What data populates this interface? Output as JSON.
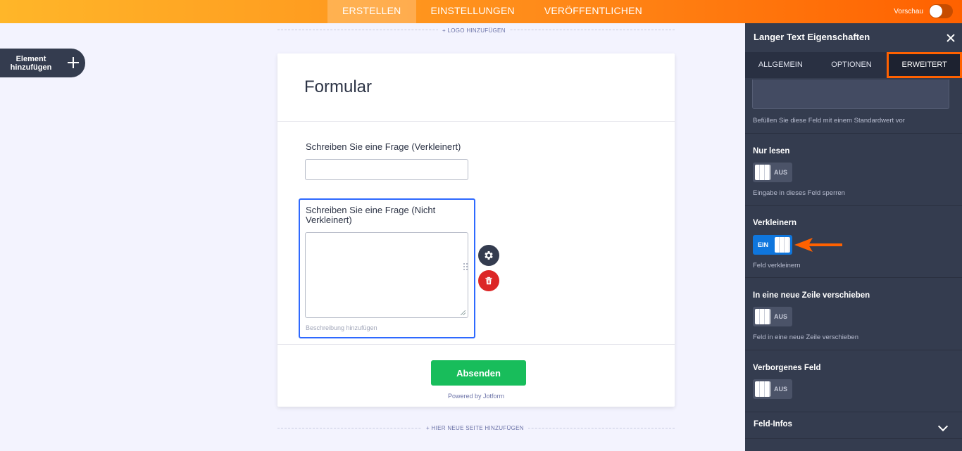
{
  "topbar": {
    "tabs": [
      "ERSTELLEN",
      "EINSTELLUNGEN",
      "VERÖFFENTLICHEN"
    ],
    "active_tab": "ERSTELLEN",
    "preview_label": "Vorschau"
  },
  "sidebar": {
    "add_element_line1": "Element",
    "add_element_line2": "hinzufügen"
  },
  "canvas": {
    "add_logo": "+ LOGO HINZUFÜGEN",
    "add_page": "+ HIER NEUE SEITE HINZUFÜGEN"
  },
  "form": {
    "title": "Formular",
    "question1_label": "Schreiben Sie eine Frage (Verkleinert)",
    "question2_label": "Schreiben Sie eine Frage (Nicht Verkleinert)",
    "description_placeholder": "Beschreibung hinzufügen",
    "submit_label": "Absenden",
    "powered_by": "Powered by Jotform"
  },
  "panel": {
    "title": "Langer Text Eigenschaften",
    "tabs": [
      "ALLGEMEIN",
      "OPTIONEN",
      "ERWEITERT"
    ],
    "active_tab": "ERWEITERT",
    "default_value_helper": "Befüllen Sie diese Feld mit einem Standardwert vor",
    "options": [
      {
        "title": "Nur lesen",
        "state": "AUS",
        "on": false,
        "helper": "Eingabe in dieses Feld sperren"
      },
      {
        "title": "Verkleinern",
        "state": "EIN",
        "on": true,
        "helper": "Feld verkleinern"
      },
      {
        "title": "In eine neue Zeile verschieben",
        "state": "AUS",
        "on": false,
        "helper": "Feld in eine neue Zeile verschieben"
      },
      {
        "title": "Verborgenes Feld",
        "state": "AUS",
        "on": false,
        "helper": ""
      }
    ],
    "accordion_label": "Feld-Infos"
  },
  "colors": {
    "accent_orange": "#ff6100",
    "panel_bg": "#343c4f",
    "toggle_on": "#0f76dd",
    "submit_green": "#18bd5b",
    "delete_red": "#dc2626",
    "selection_blue": "#2e69ff"
  }
}
